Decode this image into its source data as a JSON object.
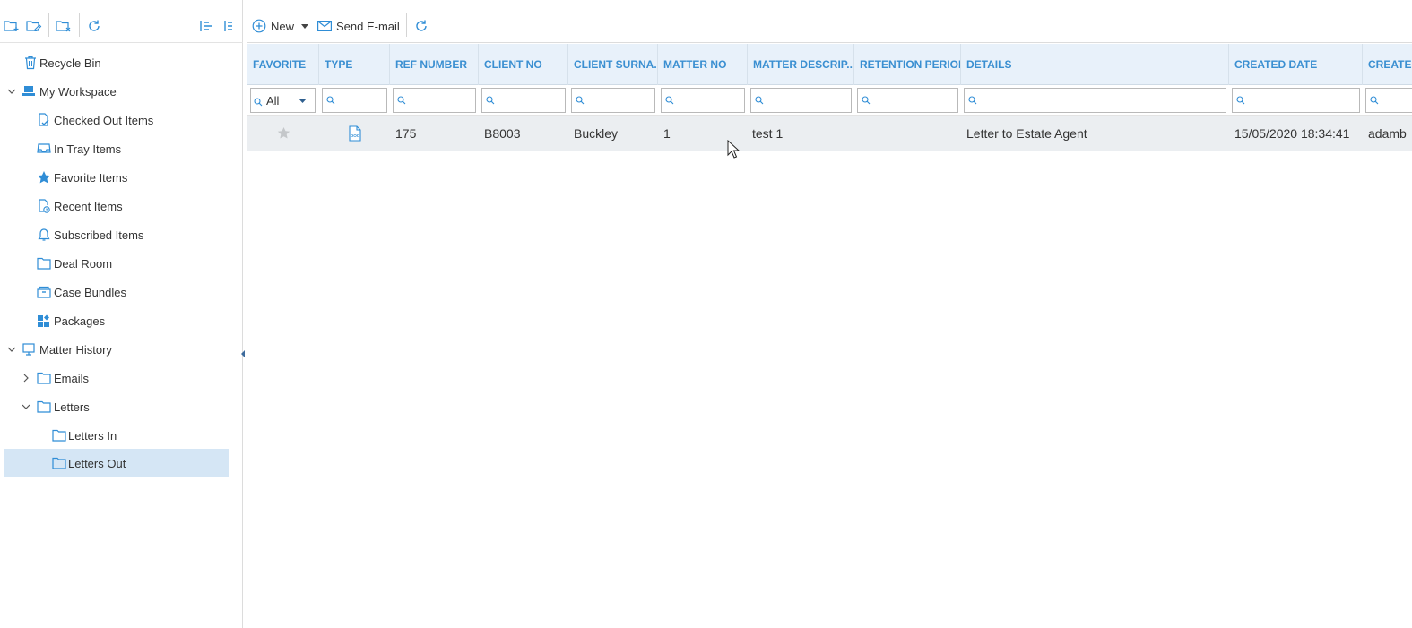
{
  "colors": {
    "accent": "#3a8fd1",
    "header_bg": "#e8f1fa",
    "selected_bg": "#d5e6f5",
    "row_bg": "#ebeef1",
    "icon_blue": "#2f8dd6"
  },
  "left_toolbar": {
    "icons": [
      "new-folder-icon",
      "edit-folder-icon",
      "delete-folder-icon",
      "refresh-icon",
      "collapse-all-icon",
      "expand-all-icon"
    ]
  },
  "tree": {
    "items": [
      {
        "label": "Recycle Bin",
        "icon": "trash-icon",
        "level": 0,
        "expanded": null
      },
      {
        "label": "My Workspace",
        "icon": "workspace-icon",
        "level": 0,
        "expanded": true
      },
      {
        "label": "Checked Out Items",
        "icon": "checked-out-icon",
        "level": 1,
        "expanded": null
      },
      {
        "label": "In Tray Items",
        "icon": "in-tray-icon",
        "level": 1,
        "expanded": null
      },
      {
        "label": "Favorite Items",
        "icon": "star-icon",
        "level": 1,
        "expanded": null
      },
      {
        "label": "Recent Items",
        "icon": "recent-icon",
        "level": 1,
        "expanded": null
      },
      {
        "label": "Subscribed Items",
        "icon": "bell-icon",
        "level": 1,
        "expanded": null
      },
      {
        "label": "Deal Room",
        "icon": "folder-icon",
        "level": 1,
        "expanded": null
      },
      {
        "label": "Case Bundles",
        "icon": "bundle-icon",
        "level": 1,
        "expanded": null
      },
      {
        "label": "Packages",
        "icon": "packages-icon",
        "level": 1,
        "expanded": null
      },
      {
        "label": "Matter History",
        "icon": "matter-history-icon",
        "level": 0,
        "expanded": true
      },
      {
        "label": "Emails",
        "icon": "folder-icon",
        "level": 1,
        "expanded": false
      },
      {
        "label": "Letters",
        "icon": "folder-icon",
        "level": 1,
        "expanded": true
      },
      {
        "label": "Letters In",
        "icon": "folder-icon",
        "level": 2,
        "expanded": null
      },
      {
        "label": "Letters Out",
        "icon": "folder-icon",
        "level": 2,
        "expanded": null,
        "selected": true
      }
    ]
  },
  "toolbar": {
    "new_label": "New",
    "send_email_label": "Send E-mail"
  },
  "grid": {
    "columns": [
      "FAVORITE",
      "TYPE",
      "REF NUMBER",
      "CLIENT NO",
      "CLIENT SURNA...",
      "MATTER NO",
      "MATTER DESCRIP...",
      "RETENTION PERIOD",
      "DETAILS",
      "CREATED DATE",
      "CREATE"
    ],
    "favorite_filter": "All",
    "rows": [
      {
        "favorite": false,
        "type_icon": "doc-file-icon",
        "type_text": "DOC",
        "ref_number": "175",
        "client_no": "B8003",
        "client_surname": "Buckley",
        "matter_no": "1",
        "matter_description": "test 1",
        "retention_period": "",
        "details": "Letter to Estate Agent",
        "created_date": "15/05/2020 18:34:41",
        "created_by": "adamb"
      }
    ]
  }
}
